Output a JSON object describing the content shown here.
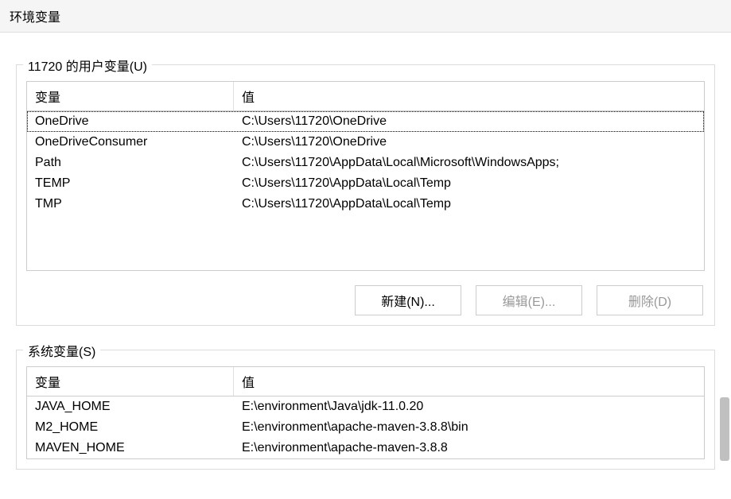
{
  "title": "环境变量",
  "userSection": {
    "label": "11720 的用户变量(U)",
    "headers": {
      "variable": "变量",
      "value": "值"
    },
    "rows": [
      {
        "variable": "OneDrive",
        "value": "C:\\Users\\11720\\OneDrive",
        "selected": true
      },
      {
        "variable": "OneDriveConsumer",
        "value": "C:\\Users\\11720\\OneDrive",
        "selected": false
      },
      {
        "variable": "Path",
        "value": "C:\\Users\\11720\\AppData\\Local\\Microsoft\\WindowsApps;",
        "selected": false
      },
      {
        "variable": "TEMP",
        "value": "C:\\Users\\11720\\AppData\\Local\\Temp",
        "selected": false
      },
      {
        "variable": "TMP",
        "value": "C:\\Users\\11720\\AppData\\Local\\Temp",
        "selected": false
      }
    ],
    "buttons": {
      "new": "新建(N)...",
      "edit": "编辑(E)...",
      "delete": "删除(D)"
    }
  },
  "systemSection": {
    "label": "系统变量(S)",
    "headers": {
      "variable": "变量",
      "value": "值"
    },
    "rows": [
      {
        "variable": "JAVA_HOME",
        "value": "E:\\environment\\Java\\jdk-11.0.20",
        "selected": false
      },
      {
        "variable": "M2_HOME",
        "value": "E:\\environment\\apache-maven-3.8.8\\bin",
        "selected": false
      },
      {
        "variable": "MAVEN_HOME",
        "value": "E:\\environment\\apache-maven-3.8.8",
        "selected": false
      }
    ]
  }
}
